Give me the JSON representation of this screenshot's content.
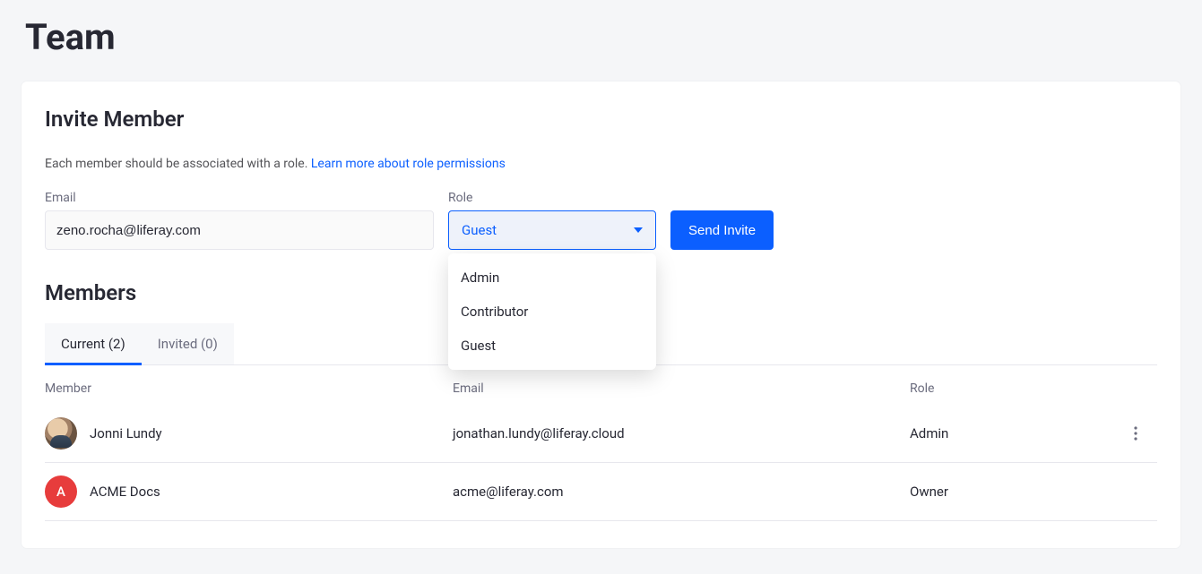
{
  "page": {
    "title": "Team"
  },
  "invite": {
    "heading": "Invite Member",
    "helper_text": "Each member should be associated with a role. ",
    "learn_more": "Learn more about role permissions",
    "email_label": "Email",
    "email_value": "zeno.rocha@liferay.com",
    "role_label": "Role",
    "role_selected": "Guest",
    "role_options": [
      "Admin",
      "Contributor",
      "Guest"
    ],
    "send_label": "Send Invite"
  },
  "members": {
    "heading": "Members",
    "tabs": {
      "current": "Current (2)",
      "invited": "Invited (0)"
    },
    "columns": {
      "member": "Member",
      "email": "Email",
      "role": "Role"
    },
    "rows": [
      {
        "name": "Jonni Lundy",
        "email": "jonathan.lundy@liferay.cloud",
        "role": "Admin",
        "avatar_type": "photo",
        "initial": "",
        "show_more": true
      },
      {
        "name": "ACME Docs",
        "email": "acme@liferay.com",
        "role": "Owner",
        "avatar_type": "letter",
        "initial": "A",
        "show_more": false
      }
    ]
  }
}
